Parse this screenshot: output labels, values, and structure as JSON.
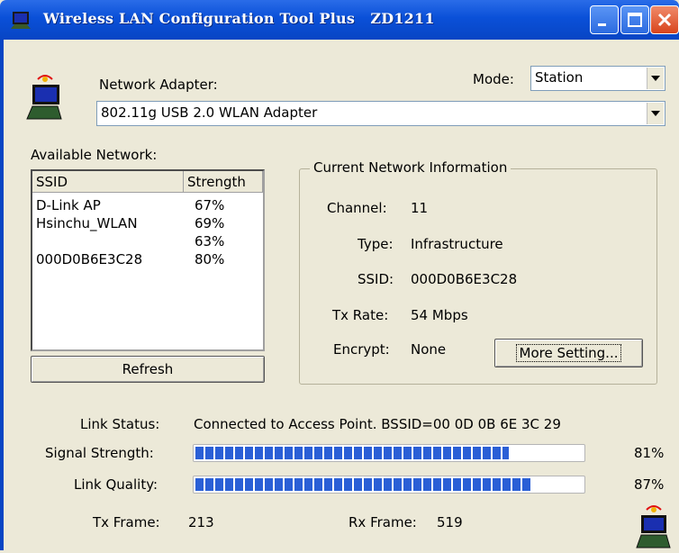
{
  "window": {
    "title": "Wireless LAN Configuration Tool Plus   ZD1211"
  },
  "adapter": {
    "label": "Network Adapter:",
    "value": "802.11g USB 2.0 WLAN Adapter"
  },
  "mode": {
    "label": "Mode:",
    "value": "Station"
  },
  "available": {
    "label": "Available Network:",
    "headers": {
      "ssid": "SSID",
      "strength": "Strength"
    },
    "rows": [
      {
        "ssid": "D-Link AP",
        "strength": "67%"
      },
      {
        "ssid": "Hsinchu_WLAN",
        "strength": "69%"
      },
      {
        "ssid": "",
        "strength": "63%"
      },
      {
        "ssid": "000D0B6E3C28",
        "strength": "80%"
      }
    ],
    "refresh_label": "Refresh"
  },
  "current": {
    "title": "Current Network Information",
    "channel_label": "Channel:",
    "channel": "11",
    "type_label": "Type:",
    "type": "Infrastructure",
    "ssid_label": "SSID:",
    "ssid": "000D0B6E3C28",
    "txrate_label": "Tx Rate:",
    "txrate": "54 Mbps",
    "encrypt_label": "Encrypt:",
    "encrypt": "None",
    "more_label": "More Setting..."
  },
  "status": {
    "link_label": "Link Status:",
    "link_value": "Connected to Access Point. BSSID=00 0D 0B 6E 3C 29",
    "signal_label": "Signal Strength:",
    "signal_pct": "81%",
    "signal_fraction": 0.81,
    "quality_label": "Link Quality:",
    "quality_pct": "87%",
    "quality_fraction": 0.87,
    "tx_label": "Tx Frame:",
    "tx": "213",
    "rx_label": "Rx Frame:",
    "rx": "519"
  },
  "icons": [
    "wlan-app-icon",
    "minimize-icon",
    "maximize-icon",
    "close-icon",
    "dropdown-arrow-icon",
    "wireless-computer-icon"
  ],
  "colors": {
    "titlebar": "#0a50d8",
    "progress": "#2a5fd6",
    "close": "#d8441c"
  }
}
